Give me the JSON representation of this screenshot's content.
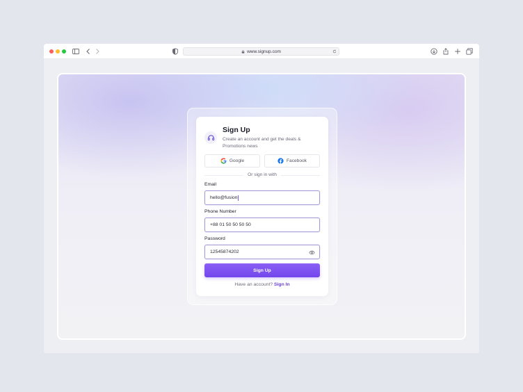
{
  "browser": {
    "url": "www.signup.com"
  },
  "signup": {
    "title": "Sign Up",
    "subtitle": "Create an account and get the deals & Promotions news",
    "google_label": "Google",
    "facebook_label": "Facebook",
    "divider": "Or sign in with",
    "email_label": "Email",
    "email_value": "hello@fusion",
    "phone_label": "Phone Number",
    "phone_value": "+88 01 50 50 50 50",
    "password_label": "Password",
    "password_value": "12545874202",
    "submit_label": "Sign Up",
    "footer_prompt": "Have an account?",
    "footer_link": "Sign In"
  },
  "colors": {
    "accent": "#7346ec",
    "field_border": "#a99ad8"
  },
  "icons": {
    "logo": "headset-icon",
    "password_toggle": "eye-icon"
  }
}
